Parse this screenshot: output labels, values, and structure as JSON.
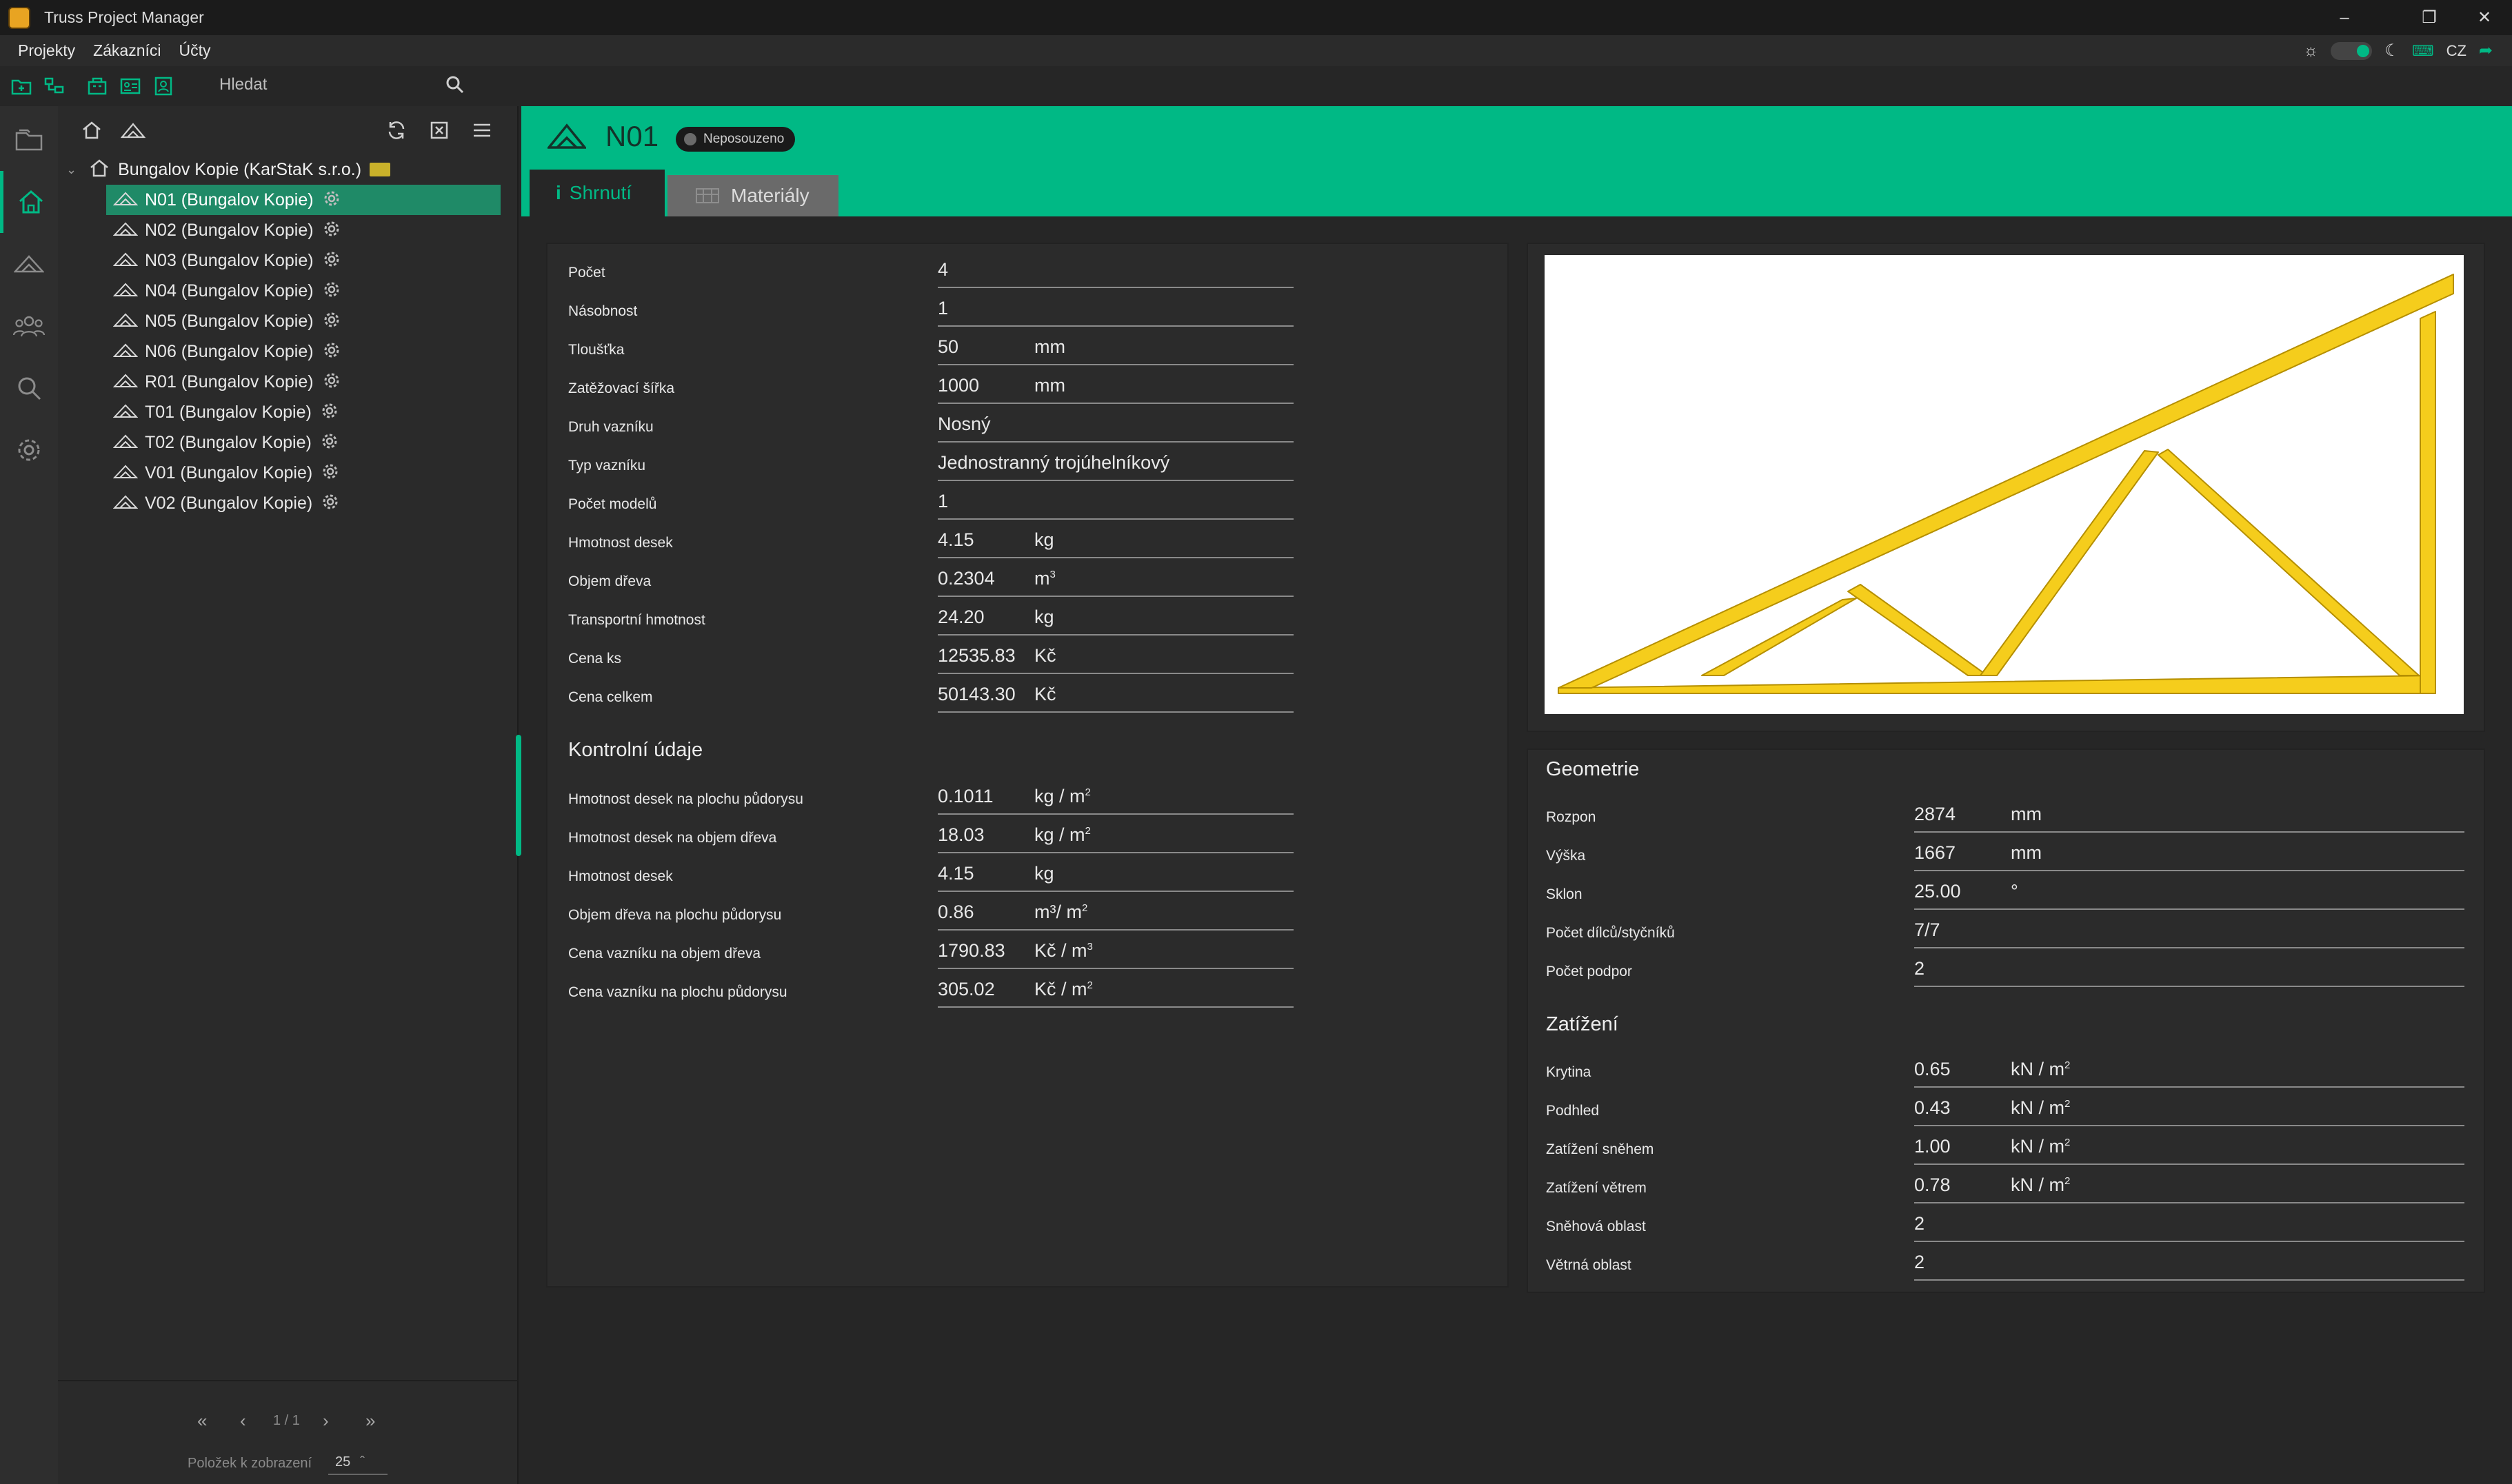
{
  "app": {
    "title": "Truss Project Manager"
  },
  "menu": {
    "items": [
      "Projekty",
      "Zákazníci",
      "Účty"
    ],
    "language": "CZ"
  },
  "toolbar": {
    "search_placeholder": "Hledat"
  },
  "tree": {
    "root": "Bungalov Kopie (KarStaK s.r.o.)",
    "items": [
      "N01 (Bungalov Kopie)",
      "N02 (Bungalov Kopie)",
      "N03 (Bungalov Kopie)",
      "N04 (Bungalov Kopie)",
      "N05 (Bungalov Kopie)",
      "N06 (Bungalov Kopie)",
      "R01 (Bungalov Kopie)",
      "T01 (Bungalov Kopie)",
      "T02 (Bungalov Kopie)",
      "V01 (Bungalov Kopie)",
      "V02 (Bungalov Kopie)"
    ],
    "selected_index": 0,
    "pager": {
      "page": "1 / 1",
      "per_page_label": "Položek k zobrazení",
      "per_page": "25"
    }
  },
  "header": {
    "title": "N01",
    "status": "Neposouzeno"
  },
  "tabs": {
    "summary": "Shrnutí",
    "materials": "Materiály"
  },
  "summary": {
    "rows": [
      {
        "label": "Počet",
        "value": "4",
        "unit": ""
      },
      {
        "label": "Násobnost",
        "value": "1",
        "unit": ""
      },
      {
        "label": "Tloušťka",
        "value": "50",
        "unit": "mm"
      },
      {
        "label": "Zatěžovací šířka",
        "value": "1000",
        "unit": "mm"
      },
      {
        "label": "Druh vazníku",
        "value": "Nosný",
        "unit": ""
      },
      {
        "label": "Typ vazníku",
        "value": "Jednostranný trojúhelníkový",
        "unit": ""
      },
      {
        "label": "Počet modelů",
        "value": "1",
        "unit": ""
      },
      {
        "label": "Hmotnost desek",
        "value": "4.15",
        "unit": "kg"
      },
      {
        "label": "Objem dřeva",
        "value": "0.2304",
        "unit": "m",
        "unit_sup": "3"
      },
      {
        "label": "Transportní hmotnost",
        "value": "24.20",
        "unit": "kg"
      },
      {
        "label": "Cena ks",
        "value": "12535.83",
        "unit": "Kč"
      },
      {
        "label": "Cena celkem",
        "value": "50143.30",
        "unit": "Kč"
      }
    ],
    "control_title": "Kontrolní údaje",
    "control_rows": [
      {
        "label": "Hmotnost desek na plochu půdorysu",
        "value": "0.1011",
        "unit": "kg / m",
        "unit_sup": "2"
      },
      {
        "label": "Hmotnost desek na objem dřeva",
        "value": "18.03",
        "unit": "kg / m",
        "unit_sup": "2"
      },
      {
        "label": "Hmotnost desek",
        "value": "4.15",
        "unit": "kg"
      },
      {
        "label": "Objem dřeva na plochu půdorysu",
        "value": "0.86",
        "unit": "m³/ m",
        "unit_sup": "2"
      },
      {
        "label": "Cena vazníku na objem dřeva",
        "value": "1790.83",
        "unit": "Kč / m",
        "unit_sup": "3"
      },
      {
        "label": "Cena vazníku na plochu půdorysu",
        "value": "305.02",
        "unit": "Kč / m",
        "unit_sup": "2"
      }
    ]
  },
  "geometry": {
    "title": "Geometrie",
    "rows": [
      {
        "label": "Rozpon",
        "value": "2874",
        "unit": "mm"
      },
      {
        "label": "Výška",
        "value": "1667",
        "unit": "mm"
      },
      {
        "label": "Sklon",
        "value": "25.00",
        "unit": "°"
      },
      {
        "label": "Počet dílců/styčníků",
        "value": "7/7",
        "unit": ""
      },
      {
        "label": "Počet podpor",
        "value": "2",
        "unit": ""
      }
    ]
  },
  "loads": {
    "title": "Zatížení",
    "rows": [
      {
        "label": "Krytina",
        "value": "0.65",
        "unit": "kN / m",
        "unit_sup": "2"
      },
      {
        "label": "Podhled",
        "value": "0.43",
        "unit": "kN / m",
        "unit_sup": "2"
      },
      {
        "label": "Zatížení sněhem",
        "value": "1.00",
        "unit": "kN / m",
        "unit_sup": "2"
      },
      {
        "label": "Zatížení větrem",
        "value": "0.78",
        "unit": "kN / m",
        "unit_sup": "2"
      },
      {
        "label": "Sněhová oblast",
        "value": "2",
        "unit": ""
      },
      {
        "label": "Větrná oblast",
        "value": "2",
        "unit": ""
      }
    ]
  },
  "colors": {
    "accent": "#00b985",
    "truss": "#f5cd1c",
    "truss_edge": "#b58f00"
  }
}
